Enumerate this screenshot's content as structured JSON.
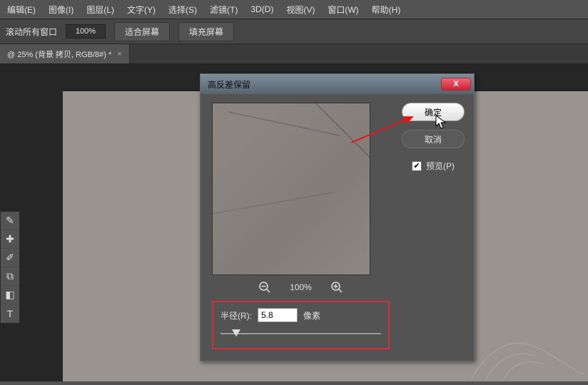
{
  "menu": [
    "编辑(E)",
    "图像(I)",
    "图层(L)",
    "文字(Y)",
    "选择(S)",
    "滤镜(T)",
    "3D(D)",
    "视图(V)",
    "窗口(W)",
    "帮助(H)"
  ],
  "options": {
    "scroll_all": "滚动所有窗口",
    "zoom_value": "100%",
    "fit_screen": "适合屏幕",
    "fill_screen": "填充屏幕"
  },
  "tab": {
    "title": "@ 25% (背景 拷贝, RGB/8#) *"
  },
  "dialog": {
    "title": "高反差保留",
    "close": "X",
    "ok": "确定",
    "cancel": "取消",
    "preview_label": "预览(P)",
    "preview_checked": "✔",
    "zoom_pct": "100%",
    "radius_label": "半径(R):",
    "radius_value": "5.8",
    "radius_unit": "像素"
  },
  "tool_icons": [
    "eyedropper",
    "healing",
    "brush",
    "stamp",
    "gradient",
    "type"
  ]
}
